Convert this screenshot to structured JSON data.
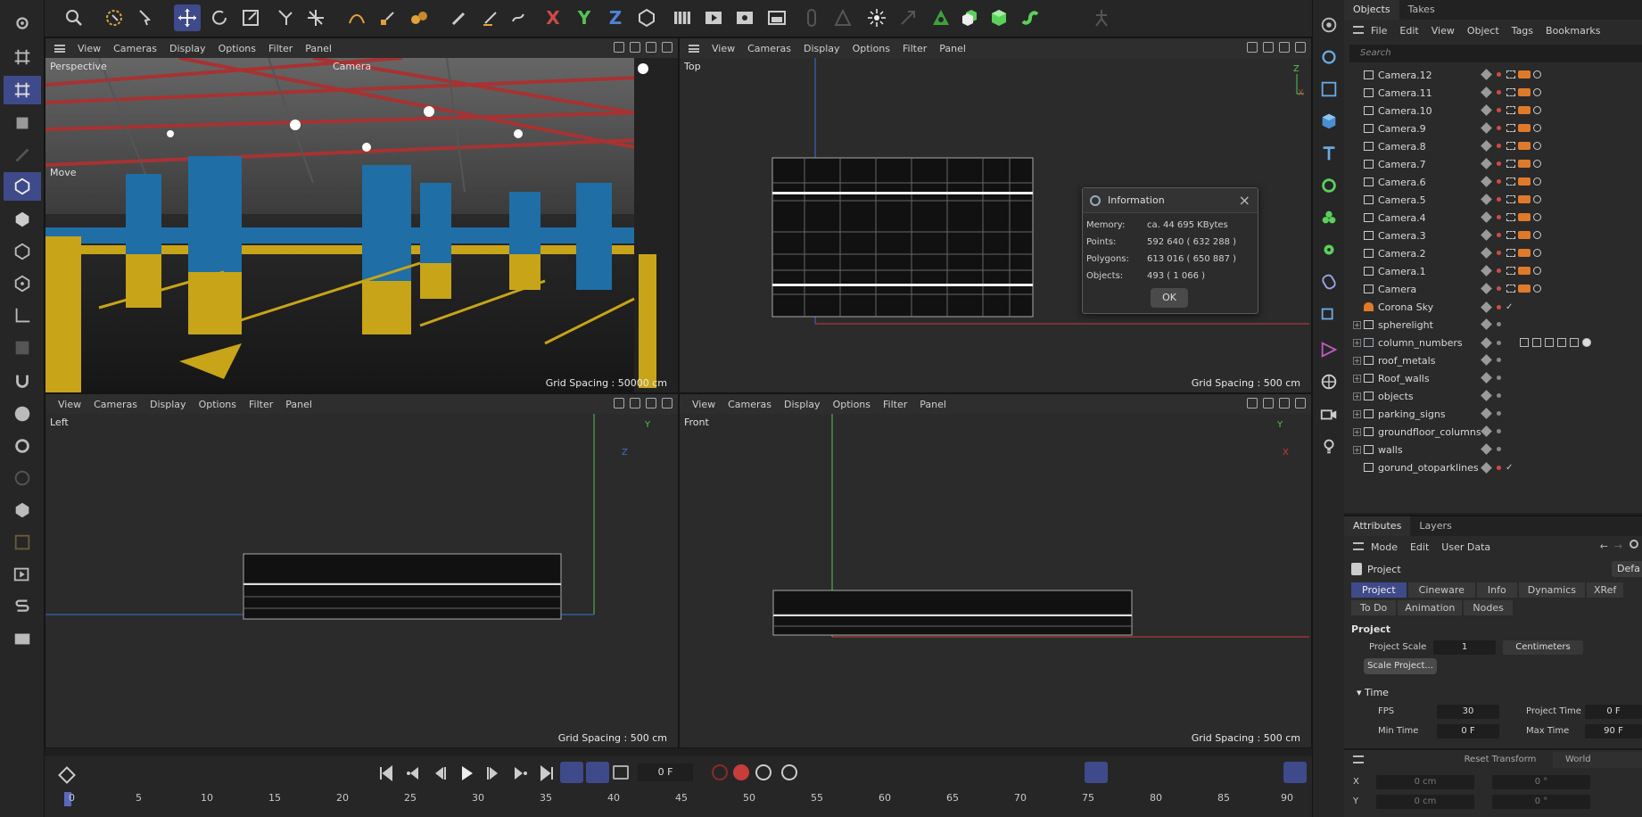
{
  "top_toolbar": {
    "axis_labels": [
      "X",
      "Y",
      "Z"
    ]
  },
  "viewports": {
    "menu": [
      "View",
      "Cameras",
      "Display",
      "Options",
      "Filter",
      "Panel"
    ],
    "perspective": {
      "label": "Perspective",
      "camera_label": "Camera",
      "mode_label": "Move",
      "grid_spacing": "Grid Spacing : 50000 cm"
    },
    "top": {
      "label": "Top",
      "grid_spacing": "Grid Spacing : 500 cm"
    },
    "left": {
      "label": "Left",
      "grid_spacing": "Grid Spacing : 500 cm"
    },
    "front": {
      "label": "Front",
      "grid_spacing": "Grid Spacing : 500 cm"
    }
  },
  "info_dialog": {
    "title": "Information",
    "rows": [
      {
        "label": "Memory:",
        "value": "ca. 44 695 KBytes"
      },
      {
        "label": "Points:",
        "value": "592 640 ( 632 288 )"
      },
      {
        "label": "Polygons:",
        "value": "613 016 ( 650 887 )"
      },
      {
        "label": "Objects:",
        "value": "493 ( 1 066 )"
      }
    ],
    "ok_label": "OK"
  },
  "objects_panel": {
    "tabs": [
      "Objects",
      "Takes"
    ],
    "menu": [
      "File",
      "Edit",
      "View",
      "Object",
      "Tags",
      "Bookmarks"
    ],
    "search_placeholder": "Search",
    "items": [
      {
        "name": "Camera.12",
        "type": "camera"
      },
      {
        "name": "Camera.11",
        "type": "camera"
      },
      {
        "name": "Camera.10",
        "type": "camera"
      },
      {
        "name": "Camera.9",
        "type": "camera"
      },
      {
        "name": "Camera.8",
        "type": "camera"
      },
      {
        "name": "Camera.7",
        "type": "camera"
      },
      {
        "name": "Camera.6",
        "type": "camera"
      },
      {
        "name": "Camera.5",
        "type": "camera"
      },
      {
        "name": "Camera.4",
        "type": "camera"
      },
      {
        "name": "Camera.3",
        "type": "camera"
      },
      {
        "name": "Camera.2",
        "type": "camera"
      },
      {
        "name": "Camera.1",
        "type": "camera"
      },
      {
        "name": "Camera",
        "type": "camera"
      },
      {
        "name": "Corona Sky",
        "type": "sky"
      },
      {
        "name": "spherelight",
        "type": "layer"
      },
      {
        "name": "column_numbers",
        "type": "special"
      },
      {
        "name": "roof_metals",
        "type": "layer"
      },
      {
        "name": "Roof_walls",
        "type": "layer"
      },
      {
        "name": "objects",
        "type": "layer"
      },
      {
        "name": "parking_signs",
        "type": "layer"
      },
      {
        "name": "groundfloor_columns",
        "type": "layer"
      },
      {
        "name": "walls",
        "type": "layer"
      },
      {
        "name": "gorund_otoparklines",
        "type": "spline"
      }
    ]
  },
  "attributes_panel": {
    "tabs": [
      "Attributes",
      "Layers"
    ],
    "menu": [
      "Mode",
      "Edit",
      "User Data"
    ],
    "object_name": "Project",
    "default_btn": "Defa",
    "subtabs_row1": [
      "Project",
      "Cineware",
      "Info",
      "Dynamics",
      "XRef"
    ],
    "subtabs_row2": [
      "To Do",
      "Animation",
      "Nodes"
    ],
    "section_title": "Project",
    "project_scale_label": "Project Scale",
    "project_scale_value": "1",
    "project_scale_unit": "Centimeters",
    "scale_project_btn": "Scale Project...",
    "time_section": "Time",
    "fps_label": "FPS",
    "fps_value": "30",
    "project_time_label": "Project Time",
    "project_time_value": "0 F",
    "min_time_label": "Min Time",
    "min_time_value": "0 F",
    "max_time_label": "Max Time",
    "max_time_value": "90 F",
    "transform_btn": "Reset Transform",
    "coord_mode": "World",
    "x_label": "X",
    "y_label": "Y",
    "x_pos": "0 cm",
    "x_rot": "0 °",
    "y_pos": "0 cm",
    "y_rot": "0 °"
  },
  "timeline": {
    "current_frame": "0 F",
    "ruler": [
      "0",
      "5",
      "10",
      "15",
      "20",
      "25",
      "30",
      "35",
      "40",
      "45",
      "50",
      "55",
      "60",
      "65",
      "70",
      "75",
      "80",
      "85",
      "90"
    ]
  }
}
